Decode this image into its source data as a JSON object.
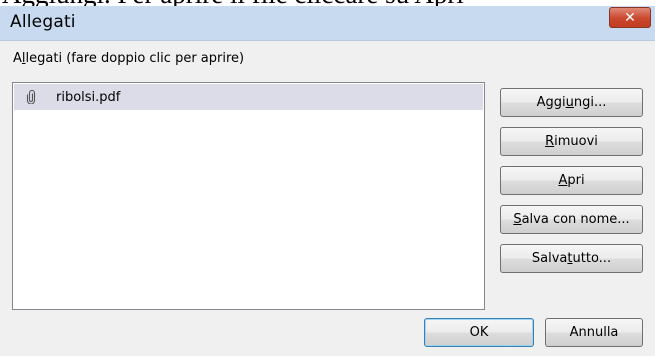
{
  "background_doc_text": "Aggiungi. Per aprire il file cliccare su Apri",
  "window": {
    "title": "Allegati",
    "close_glyph": "✕"
  },
  "list": {
    "label_pre": "A",
    "label_access": "l",
    "label_post": "legati (fare doppio clic per aprire)",
    "items": [
      {
        "icon": "paperclip-icon",
        "name": "ribolsi.pdf"
      }
    ]
  },
  "buttons": {
    "add": {
      "pre": "Aggi",
      "access": "u",
      "post": "ngi..."
    },
    "remove": {
      "pre": "",
      "access": "R",
      "post": "imuovi"
    },
    "open": {
      "pre": "",
      "access": "A",
      "post": "pri"
    },
    "save_as": {
      "pre": "",
      "access": "S",
      "post": "alva con nome..."
    },
    "save_all": {
      "pre": "Salva ",
      "access": "t",
      "post": "utto..."
    },
    "ok": "OK",
    "cancel": "Annulla"
  },
  "colors": {
    "titlebar": "#c7daf0",
    "dialog_bg": "#f0f0f0",
    "selection": "#dcdce8",
    "close_button": "#c9472d",
    "default_button_border": "#3c7fb1"
  }
}
